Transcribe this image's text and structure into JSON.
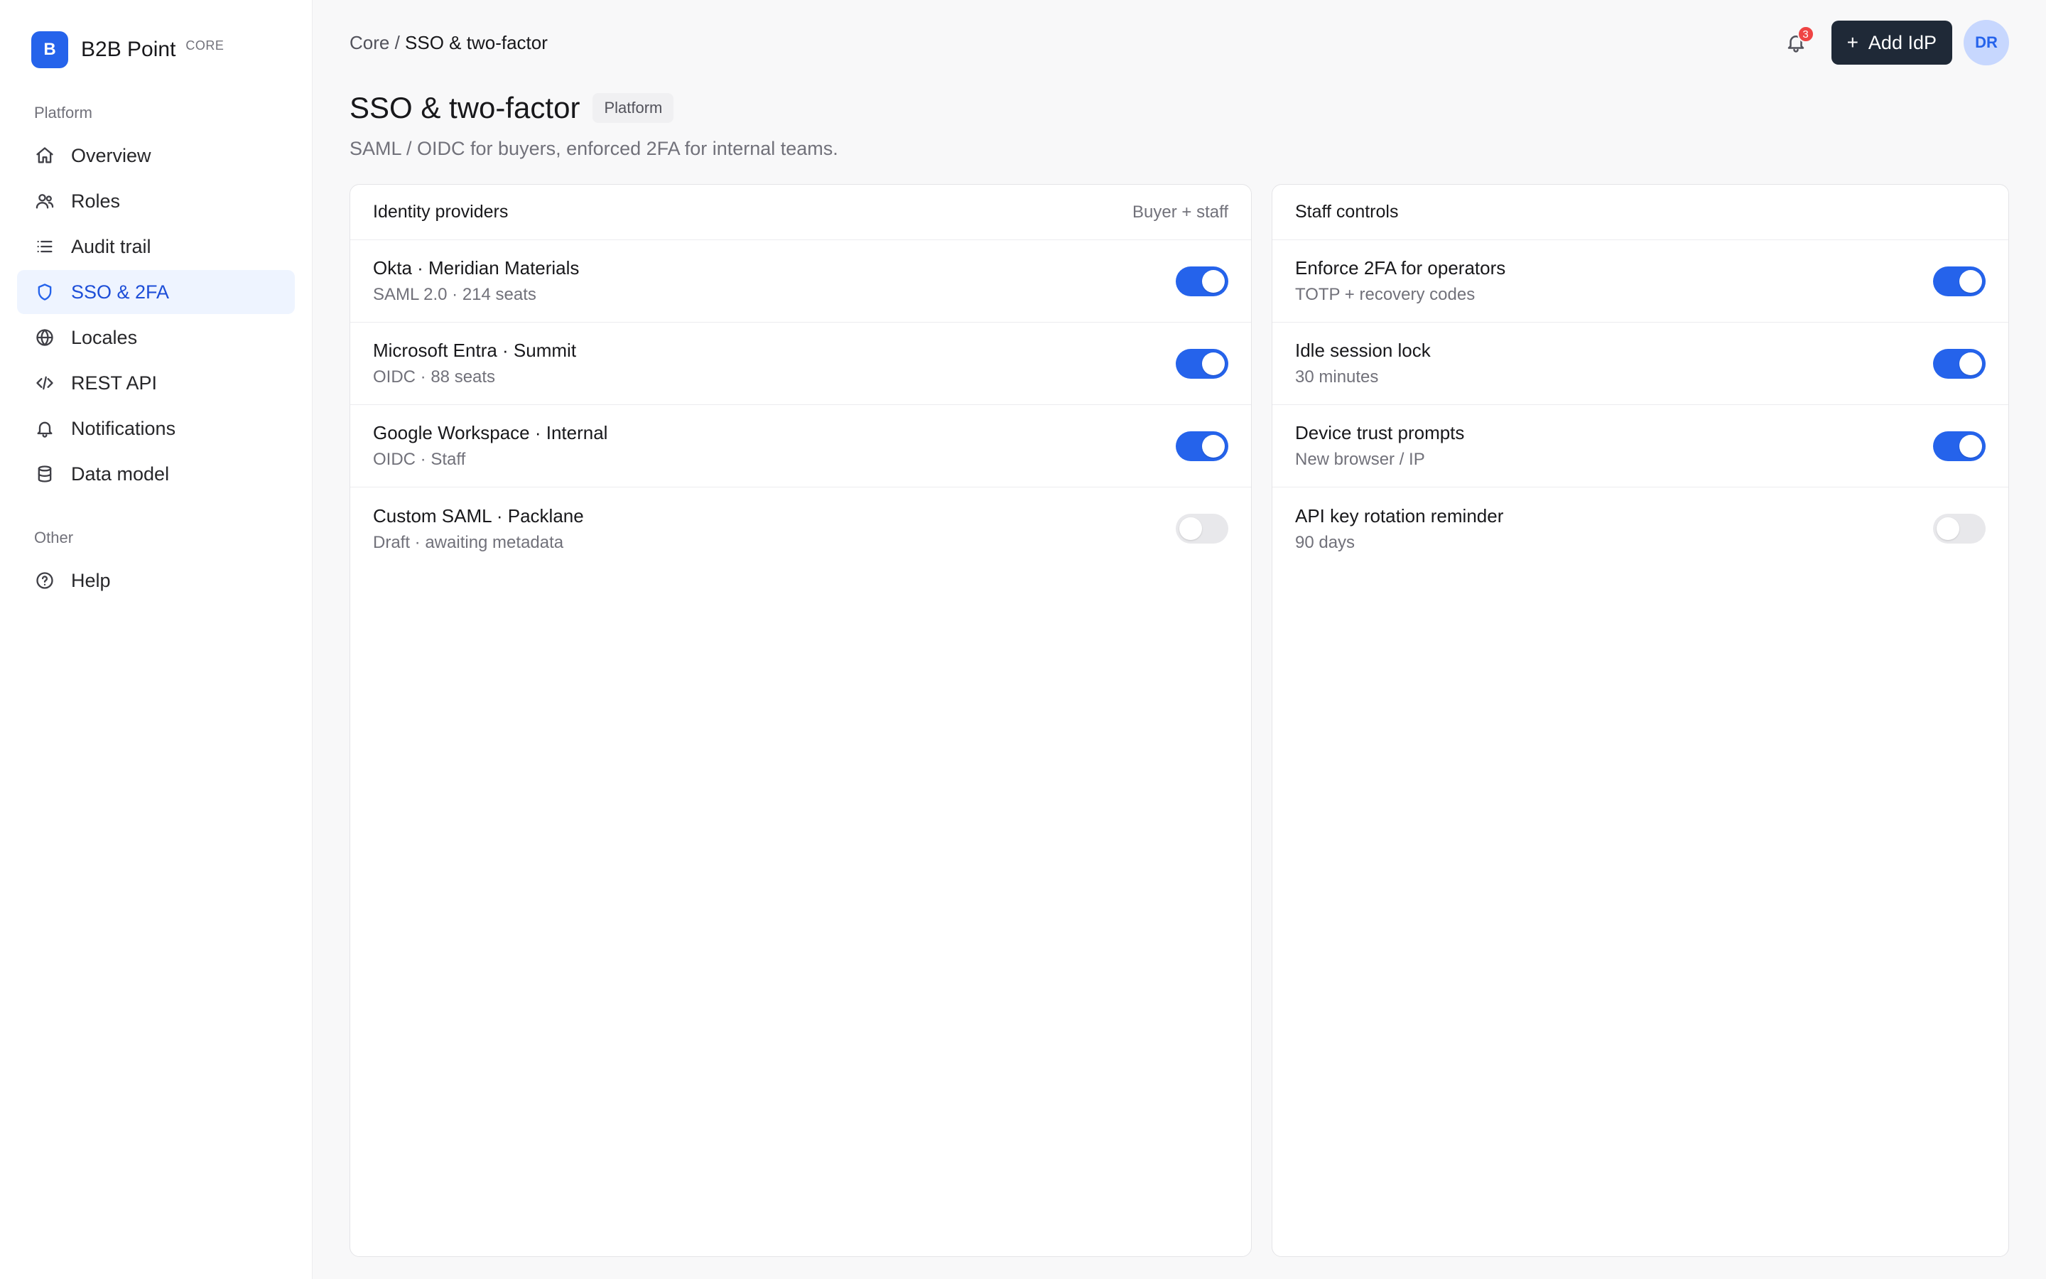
{
  "brand": {
    "logo_letter": "B",
    "name": "B2B Point",
    "tag": "CORE",
    "accent": "#2563eb"
  },
  "sidebar": {
    "section_platform": "Platform",
    "section_other": "Other",
    "items": [
      {
        "label": "Overview",
        "icon": "home-icon",
        "active": false
      },
      {
        "label": "Roles",
        "icon": "users-icon",
        "active": false
      },
      {
        "label": "Audit trail",
        "icon": "list-icon",
        "active": false
      },
      {
        "label": "SSO & 2FA",
        "icon": "shield-icon",
        "active": true
      },
      {
        "label": "Locales",
        "icon": "globe-icon",
        "active": false
      },
      {
        "label": "REST API",
        "icon": "code-icon",
        "active": false
      },
      {
        "label": "Notifications",
        "icon": "bell-icon",
        "active": false
      },
      {
        "label": "Data model",
        "icon": "database-icon",
        "active": false
      }
    ],
    "other_items": [
      {
        "label": "Help",
        "icon": "help-circle-icon",
        "active": false
      }
    ]
  },
  "header": {
    "breadcrumb_parent": "Core /",
    "breadcrumb_current": "SSO & two-factor",
    "notification_count": "3",
    "add_button_plus": "+",
    "add_button_label": "Add IdP",
    "avatar_initials": "DR"
  },
  "page": {
    "title": "SSO & two-factor",
    "chip": "Platform",
    "subtitle": "SAML / OIDC for buyers, enforced 2FA for internal teams."
  },
  "identity_providers": {
    "title": "Identity providers",
    "meta": "Buyer + staff",
    "rows": [
      {
        "title": "Okta · Meridian Materials",
        "sub": "SAML 2.0 · 214 seats",
        "enabled": true
      },
      {
        "title": "Microsoft Entra · Summit",
        "sub": "OIDC · 88 seats",
        "enabled": true
      },
      {
        "title": "Google Workspace · Internal",
        "sub": "OIDC · Staff",
        "enabled": true
      },
      {
        "title": "Custom SAML · Packlane",
        "sub": "Draft · awaiting metadata",
        "enabled": false
      }
    ]
  },
  "staff_controls": {
    "title": "Staff controls",
    "rows": [
      {
        "title": "Enforce 2FA for operators",
        "sub": "TOTP + recovery codes",
        "enabled": true
      },
      {
        "title": "Idle session lock",
        "sub": "30 minutes",
        "enabled": true
      },
      {
        "title": "Device trust prompts",
        "sub": "New browser / IP",
        "enabled": true
      },
      {
        "title": "API key rotation reminder",
        "sub": "90 days",
        "enabled": false
      }
    ]
  }
}
